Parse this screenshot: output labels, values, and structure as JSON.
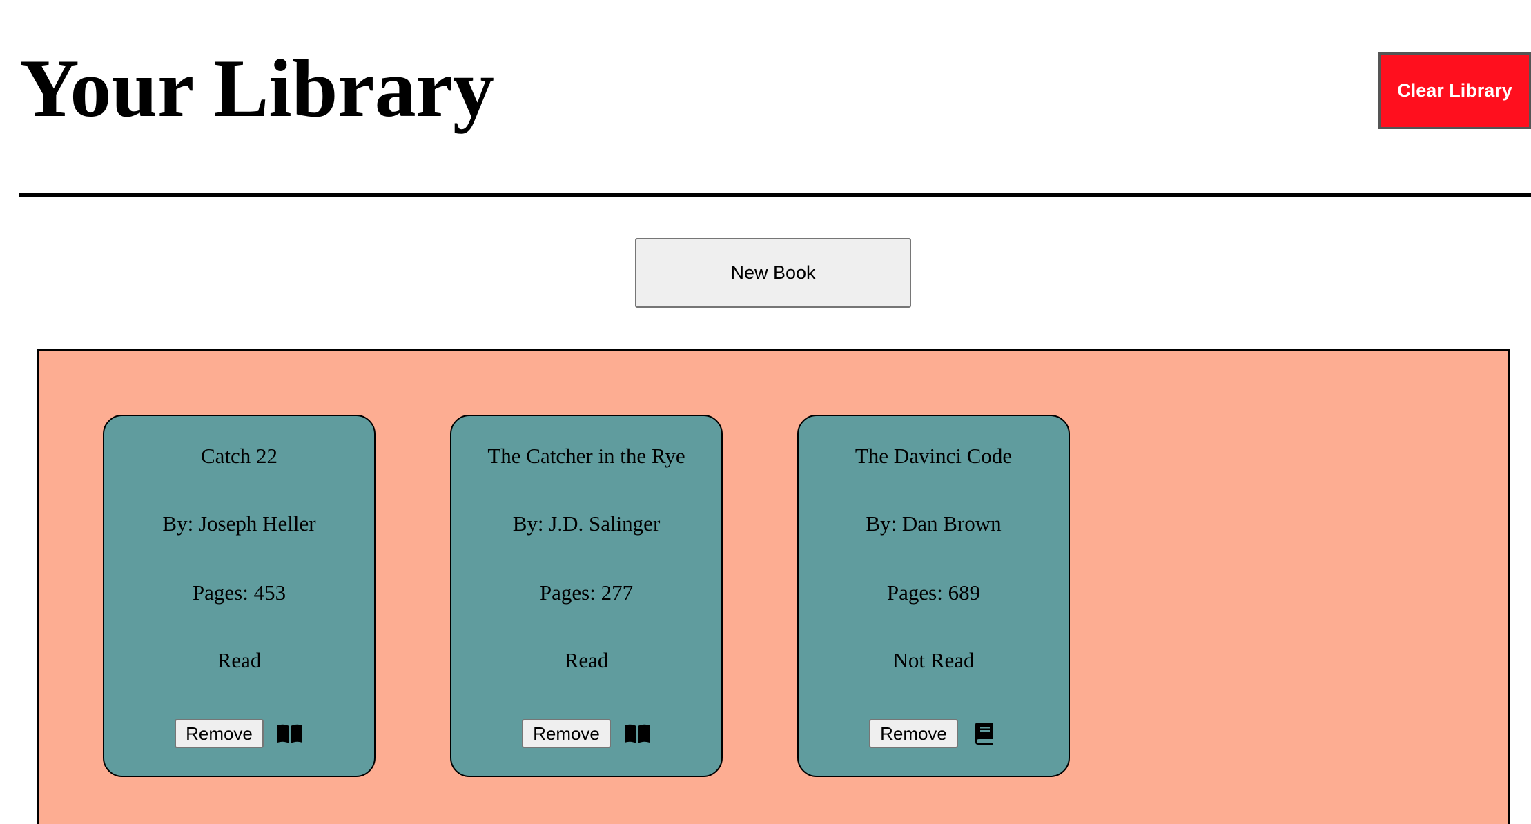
{
  "header": {
    "title": "Your Library",
    "clear_label": "Clear Library"
  },
  "toolbar": {
    "new_book_label": "New Book"
  },
  "colors": {
    "clear_button": "#ff0f1e",
    "library_background": "#fdad92",
    "card_background": "#609c9e"
  },
  "books": [
    {
      "title": "Catch 22",
      "author": "By: Joseph Heller",
      "pages": "Pages: 453",
      "status": "Read",
      "remove_label": "Remove",
      "toggle_icon": "open-book-icon"
    },
    {
      "title": "The Catcher in the Rye",
      "author": "By: J.D. Salinger",
      "pages": "Pages: 277",
      "status": "Read",
      "remove_label": "Remove",
      "toggle_icon": "open-book-icon"
    },
    {
      "title": "The Davinci Code",
      "author": "By: Dan Brown",
      "pages": "Pages: 689",
      "status": "Not Read",
      "remove_label": "Remove",
      "toggle_icon": "closed-book-icon"
    }
  ]
}
